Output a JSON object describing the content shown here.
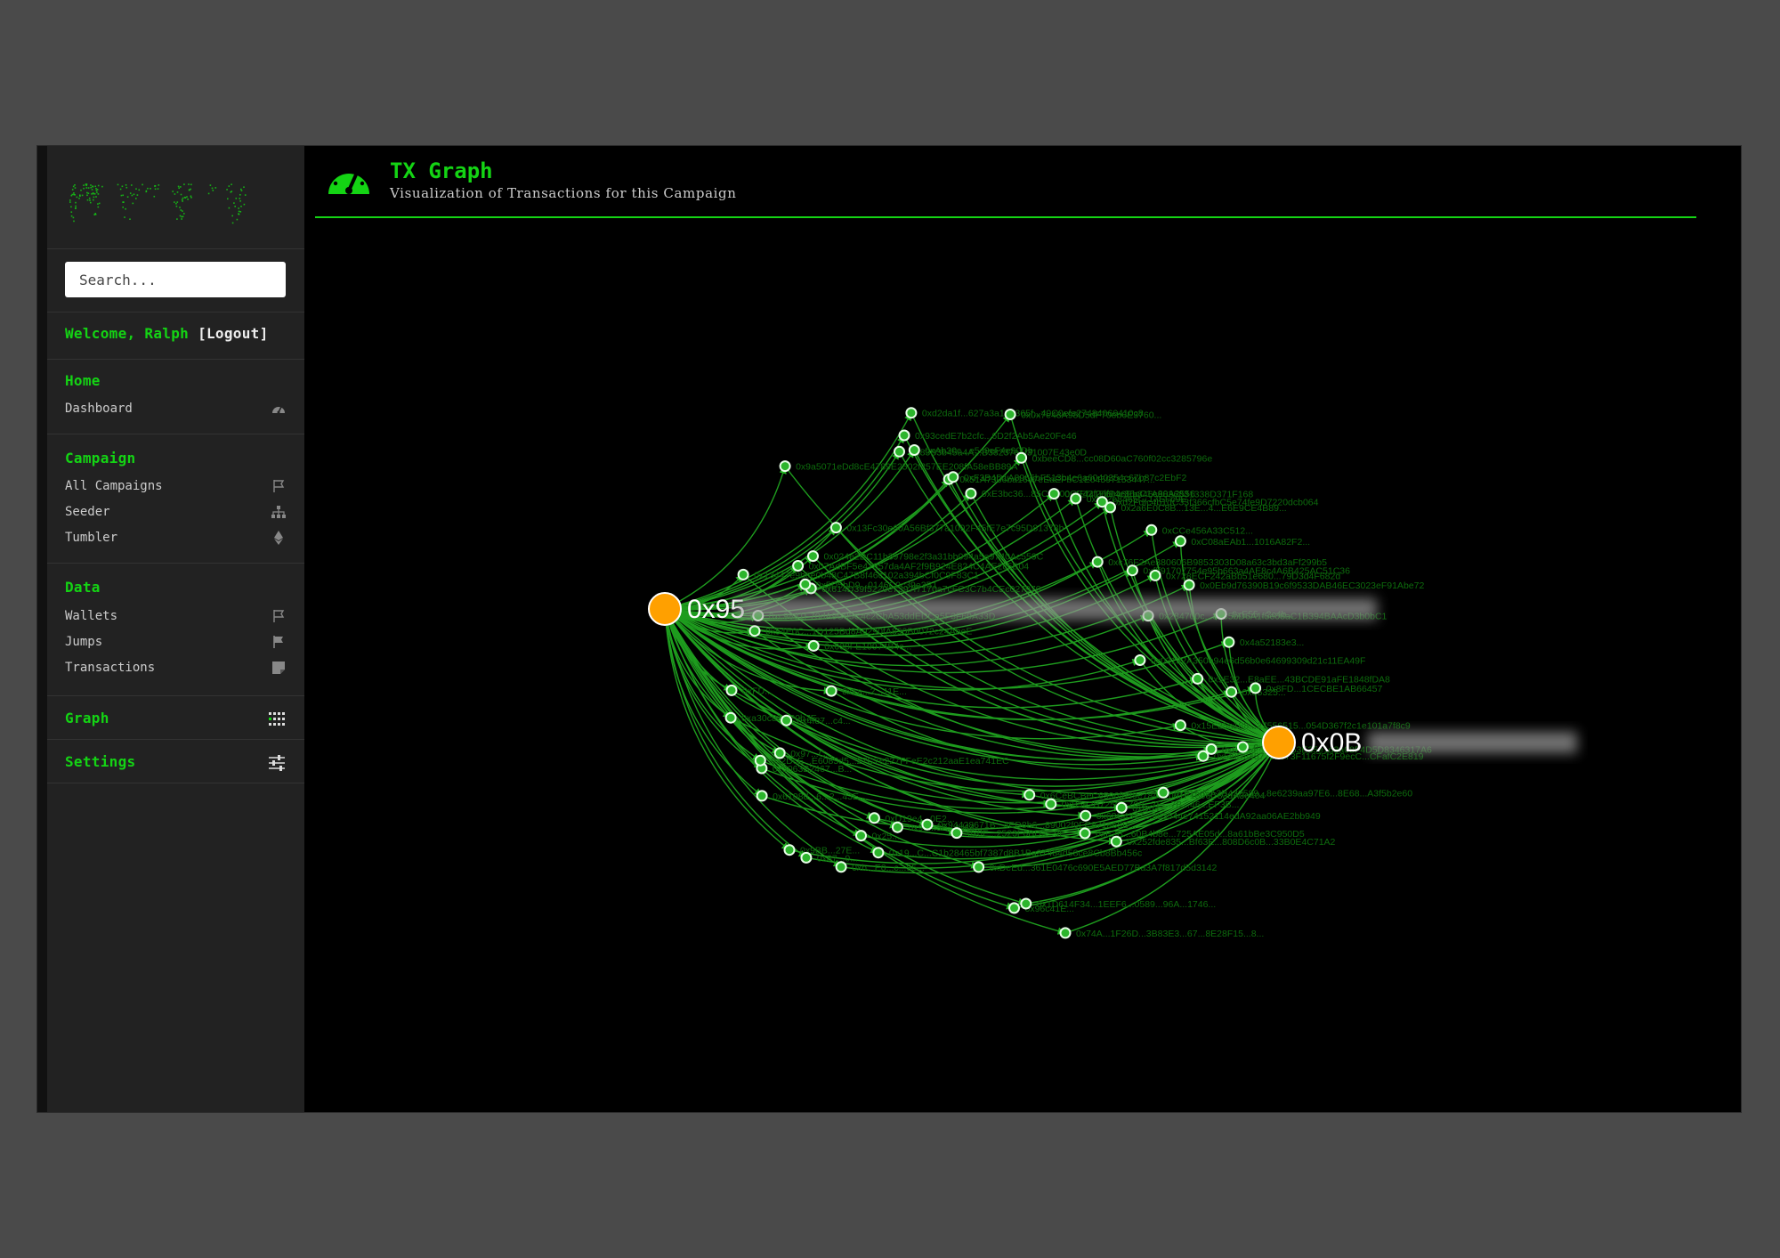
{
  "app": {
    "colors": {
      "accent": "#14d414",
      "hub": "#ffa000",
      "node": "#2cb52c",
      "edge": "#1e9c1e",
      "label": "#0d6b0d",
      "background": "#000000",
      "sidebar": "#222222"
    }
  },
  "sidebar": {
    "logo_icon": "ascii-art-logo",
    "search": {
      "placeholder": "Search..."
    },
    "welcome": {
      "text": "Welcome, Ralph",
      "logout": "[Logout]"
    },
    "sections": [
      {
        "label": "Home",
        "items": [
          {
            "label": "Dashboard",
            "icon": "gauge-icon"
          }
        ]
      },
      {
        "label": "Campaign",
        "items": [
          {
            "label": "All Campaigns",
            "icon": "flag-outline-icon"
          },
          {
            "label": "Seeder",
            "icon": "sitemap-icon"
          },
          {
            "label": "Tumbler",
            "icon": "ethereum-icon"
          }
        ]
      },
      {
        "label": "Data",
        "items": [
          {
            "label": "Wallets",
            "icon": "flag-outline-icon"
          },
          {
            "label": "Jumps",
            "icon": "flag-icon"
          },
          {
            "label": "Transactions",
            "icon": "sticky-note-icon"
          }
        ]
      },
      {
        "label": "Graph",
        "icon": "grid-dots-icon"
      },
      {
        "label": "Settings",
        "icon": "sliders-icon"
      }
    ]
  },
  "header": {
    "title": "TX Graph",
    "subtitle": "Visualization of Transactions for this Campaign",
    "icon": "gauge-icon"
  },
  "graph": {
    "hubs": [
      {
        "label": "0x95"
      },
      {
        "label": "0x0B"
      }
    ],
    "leaves": [
      "0x638FE19974B4c...",
      "0x54E0C...1D125Bd8A9290fA890Bd072c24AbeE",
      "0xc9881F70dA9C85C4c2CbA53ddEDCa5F3F69A33D",
      "0x614D39f5220e7397f7170a7cFC3C7b4CEc027970",
      "0x5D5bD9...0146C0c39e3B1",
      "0x024e2DC11b39798e2f3a31bb094a5a9740Ac559C",
      "0x07AdBF5e47857da4AF2f9B924E824C4AE2c5B04",
      "0x13447e9b8e0b48C47B8f46c102a394bCf0C9F83C1",
      "0x13Fc30e60A56Bf377a1092F45fE7e7c95D81378b",
      "0x9a5071eDd8cE4789E2502f257EE208fA58eBB89A",
      "0x83B3b45a4A...B38237e5f31007E43e0D",
      "0xAb30c...e5c9eF4e90Db",
      "0x93cedE7b2cfc...6D2f2Ab5Ae20Fe46",
      "0xd2da1f...627a3a102365f...40C0efe27484066410c8",
      "0x51A7336ba1647eEaEFbC1E04597153447...",
      "0xF3B4D1A8965bF513b4e6a6040354c67b87c2EbF2",
      "0xE3bc36...85CBa00CE42f2df94e86cC1A80A2556",
      "0x0x7e48A98D5dF70eb6E3760...",
      "0xbeeCD8...cc08D60aC760f02cc3285796e",
      "0x1Ef41E6046Eb846c9836831338D371F168",
      "0xb42e8465f...17EFc9E",
      "0x2a6E0C8B...13E...4...E6E9CE4B89...",
      "0xd2Fdfc4b1dC33f366cfbC5e74fe9D7220dcb064",
      "0xCCe456A33C512...",
      "0xc76F2Ae380606B9853303D08a63c3bd3aFf299b5",
      "0xC08aEAb1...1016A82F2...",
      "0xfff91707754e95b663a4AE8c4A6B425AC51C36",
      "0x728ECF242aBb51e680...79D3d4F682d",
      "0x0Eb9d76390B19c6f9533DAB46EC3023eF91Abe72",
      "0xE55...2c4b...",
      "0x284700c...3635bD6A1f5e08aC1B394BAAcD3b0bC1",
      "0x4a52183e3...",
      "0x03132A350e94e6d56b0e64699309d21c11EA49F",
      "0x9E32...E8aEE...43BCDE91aFE1848fDA8",
      "0x8FD...1CECBE1AB66457",
      "0xd5325...",
      "0x15E25a188...27556515...054D367f2c1e101a7f8c9",
      "0xB5f14...7E35e53E35e1d3a08F4D5D8346317A6",
      "0x413...",
      "0x5f0D845773b673F11675f2F9ecC...CFafC2E819",
      "0x815d5A3B432589...8e6239aa97E6...8E68...A3f5b2e60",
      "0xD04...",
      "0xE2B...60B4b8e...725AE05d...8a61bBe3C950D5",
      "0x68C4347...983544e74152114edA92aa06AE2bb949",
      "0x252fde835...Bf63E...808D6c0B...33B0E4C71A2",
      "0xB5e2B725CE709...7E...7B...46...EF3B...",
      "0x74A...1F26D...3B83E3...67...8E28F15...8...",
      "0x1D614F34...1EEF6...0589...96A...1746...",
      "0x6CeBCBeC6596f0d9e784b20d1F1806C83dA3e404",
      "0x96c41E...",
      "0xDeEd...361E0476c690E5AED77Ba3A7f817d5d3142",
      "0x0E...2523F6BD3...9E",
      "0x94428671B...4ED8b6...89002f0FC871a65B...",
      "0x9d...3F...4d44...",
      "0x19...C...C1b28465bf7387d8B1Ba37484d58ce8Cb8Bb456c",
      "0xD19e4...0E2...",
      "0x25...",
      "0xb...E0...c...95...",
      "0x9BB...27E...",
      "0x87...0...",
      "0x6108d...6...2...43E...",
      "0x3063B2467...B...",
      "0x2DcE...E6085d5...27C7e227FFeE2c212aaE1ea741EC",
      "0x97...C...",
      "0x4f87...c4...",
      "0xa30c83...20b7E...",
      "0xFD...",
      "0x1a...2...11E..."
    ]
  }
}
